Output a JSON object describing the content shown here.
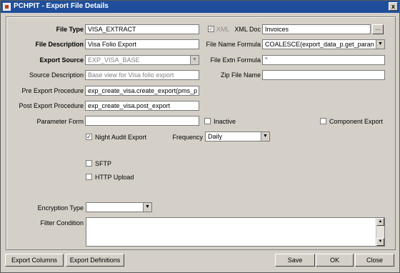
{
  "window": {
    "title": "PCHPIT - Export File Details",
    "close_glyph": "x"
  },
  "labels": {
    "file_type": "File Type",
    "file_description": "File Description",
    "export_source": "Export Source",
    "source_description": "Source Description",
    "pre_export_procedure": "Pre Export Procedure",
    "post_export_procedure": "Post Export Procedure",
    "parameter_form": "Parameter Form",
    "xml_doc": "XML Doc",
    "file_name_formula": "File Name Formula",
    "file_extn_formula": "File Extn Formula",
    "zip_file_name": "Zip File Name",
    "frequency": "Frequency",
    "encryption_type": "Encryption Type",
    "filter_condition": "Filter Condition"
  },
  "values": {
    "file_type": "VISA_EXTRACT",
    "file_description": "Visa Folio Export",
    "export_source": "EXP_VISA_BASE",
    "source_description": "Base view for Visa folio export",
    "pre_export_procedure": "exp_create_visa.create_export(pms_p",
    "post_export_procedure": "exp_create_visa.post_export",
    "parameter_form": "",
    "xml_doc": "Invoices",
    "file_name_formula": "COALESCE(export_data_p.get_paran",
    "file_extn_formula": "''",
    "zip_file_name": "",
    "frequency": "Daily",
    "encryption_type": "",
    "filter_condition": ""
  },
  "checkboxes": {
    "xml": {
      "label": "XML",
      "checked": true,
      "disabled": true
    },
    "inactive": {
      "label": "Inactive",
      "checked": false
    },
    "component_export": {
      "label": "Component Export",
      "checked": false
    },
    "night_audit_export": {
      "label": "Night Audit Export",
      "checked": true
    },
    "sftp": {
      "label": "SFTP",
      "checked": false
    },
    "http_upload": {
      "label": "HTTP Upload",
      "checked": false
    }
  },
  "glyphs": {
    "ellipsis": "...",
    "dropdown": "▼",
    "scroll_up": "▲",
    "scroll_down": "▼",
    "check": "✓"
  },
  "buttons": {
    "export_columns": "Export Columns",
    "export_definitions": "Export Definitions",
    "save": "Save",
    "ok": "OK",
    "close": "Close"
  }
}
